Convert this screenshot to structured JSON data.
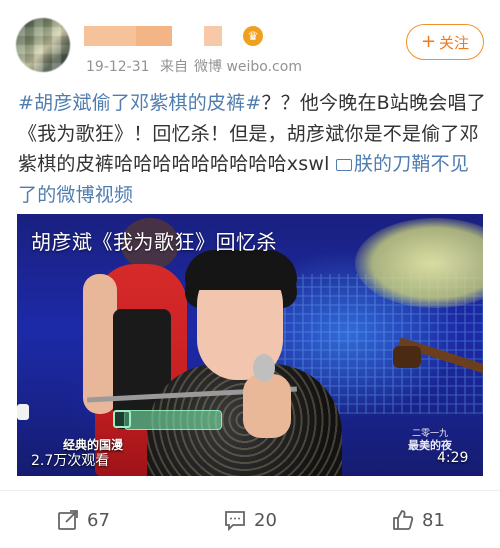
{
  "post": {
    "user": {
      "name_redacted": "",
      "badge_icon": "vip-crown-icon"
    },
    "meta": {
      "date": "19-12-31",
      "source_prefix": "来自",
      "source": "微博 weibo.com"
    },
    "follow_label": "关注",
    "follow_icon": "plus-icon",
    "text": {
      "topic": "#胡彦斌偷了邓紫棋的皮裤#",
      "body": "？？他今晚在B站晚会唱了《我为歌狂》！回忆杀！但是，胡彦斌你是不是偷了邓紫棋的皮裤哈哈哈哈哈哈哈哈哈xswl ",
      "video_link": "朕的刀鞘不见了的微博视频"
    },
    "video": {
      "title": "胡彦斌《我为歌狂》回忆杀",
      "show_label": "经典的国漫",
      "views": "2.7万次观看",
      "duration": "4:29",
      "logo_line1": "二零一九",
      "logo_line2": "最美的夜"
    },
    "actions": {
      "repost_count": "67",
      "comment_count": "20",
      "like_count": "81"
    }
  },
  "colors": {
    "link_blue": "#507daf",
    "follow_orange": "#eb7a1f",
    "meta_gray": "#939393"
  }
}
